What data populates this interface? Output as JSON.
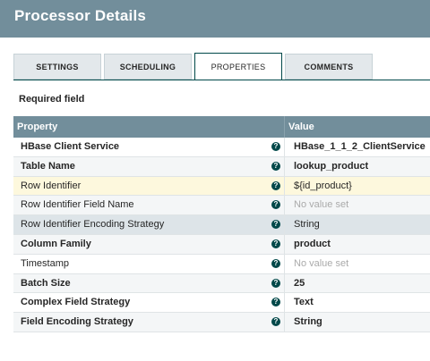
{
  "dialog": {
    "title": "Processor Details"
  },
  "tabs": [
    {
      "label": "SETTINGS"
    },
    {
      "label": "SCHEDULING"
    },
    {
      "label": "PROPERTIES"
    },
    {
      "label": "COMMENTS"
    }
  ],
  "active_tab": "PROPERTIES",
  "required_field_label": "Required field",
  "table": {
    "headers": {
      "property": "Property",
      "value": "Value"
    },
    "rows": [
      {
        "property": "HBase Client Service",
        "value": "HBase_1_1_2_ClientService",
        "required": true
      },
      {
        "property": "Table Name",
        "value": "lookup_product",
        "required": true
      },
      {
        "property": "Row Identifier",
        "value": "${id_product}",
        "required": false
      },
      {
        "property": "Row Identifier Field Name",
        "value": "No value set",
        "required": false
      },
      {
        "property": "Row Identifier Encoding Strategy",
        "value": "String",
        "required": false
      },
      {
        "property": "Column Family",
        "value": "product",
        "required": true
      },
      {
        "property": "Timestamp",
        "value": "No value set",
        "required": false
      },
      {
        "property": "Batch Size",
        "value": "25",
        "required": true
      },
      {
        "property": "Complex Field Strategy",
        "value": "Text",
        "required": true
      },
      {
        "property": "Field Encoding Strategy",
        "value": "String",
        "required": true
      }
    ],
    "help_icon": "question-circle-icon"
  },
  "colors": {
    "header_bg": "#728e9b",
    "accent": "#004849",
    "highlight_row": "#fdf8dd"
  }
}
